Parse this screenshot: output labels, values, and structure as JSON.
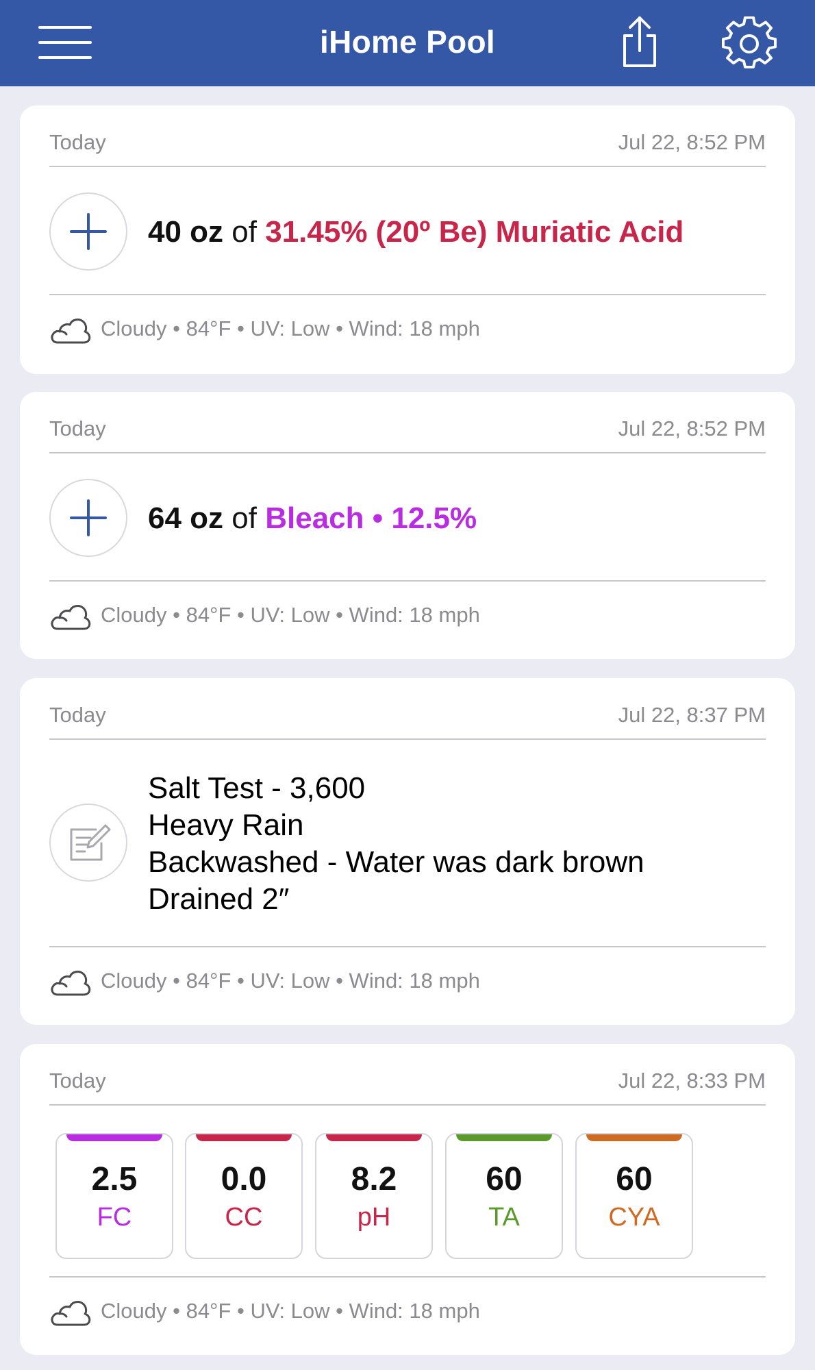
{
  "app": {
    "title": "iHome Pool"
  },
  "colors": {
    "navbar": "#3558a6",
    "acid": "#c7264a",
    "bleach": "#b92ce1",
    "fc": "#b92ce1",
    "cc": "#c7264a",
    "ph": "#c7264a",
    "ta": "#5a9a2a",
    "cya": "#cf6a22"
  },
  "icons": {
    "menu": "hamburger-menu-icon",
    "share": "share-icon",
    "settings": "gear-icon",
    "add": "plus-icon",
    "note": "note-edit-icon",
    "weather": "cloud-icon"
  },
  "entries": [
    {
      "day": "Today",
      "time": "Jul 22, 8:52 PM",
      "amount": "40 oz",
      "of": "of",
      "chemical": "31.45% (20º Be) Muriatic Acid",
      "weather": "Cloudy • 84°F • UV: Low • Wind: 18 mph"
    },
    {
      "day": "Today",
      "time": "Jul 22, 8:52 PM",
      "amount": "64 oz",
      "of": "of",
      "chemical": "Bleach • 12.5%",
      "weather": "Cloudy • 84°F • UV: Low • Wind: 18 mph"
    },
    {
      "day": "Today",
      "time": "Jul 22, 8:37 PM",
      "lines": [
        "Salt Test - 3,600",
        "Heavy Rain",
        "Backwashed - Water was dark brown",
        "Drained 2″"
      ],
      "weather": "Cloudy • 84°F • UV: Low • Wind: 18 mph"
    },
    {
      "day": "Today",
      "time": "Jul 22, 8:33 PM",
      "tests": [
        {
          "value": "2.5",
          "label": "FC"
        },
        {
          "value": "0.0",
          "label": "CC"
        },
        {
          "value": "8.2",
          "label": "pH"
        },
        {
          "value": "60",
          "label": "TA"
        },
        {
          "value": "60",
          "label": "CYA"
        }
      ],
      "weather": "Cloudy • 84°F • UV: Low • Wind: 18 mph"
    }
  ]
}
